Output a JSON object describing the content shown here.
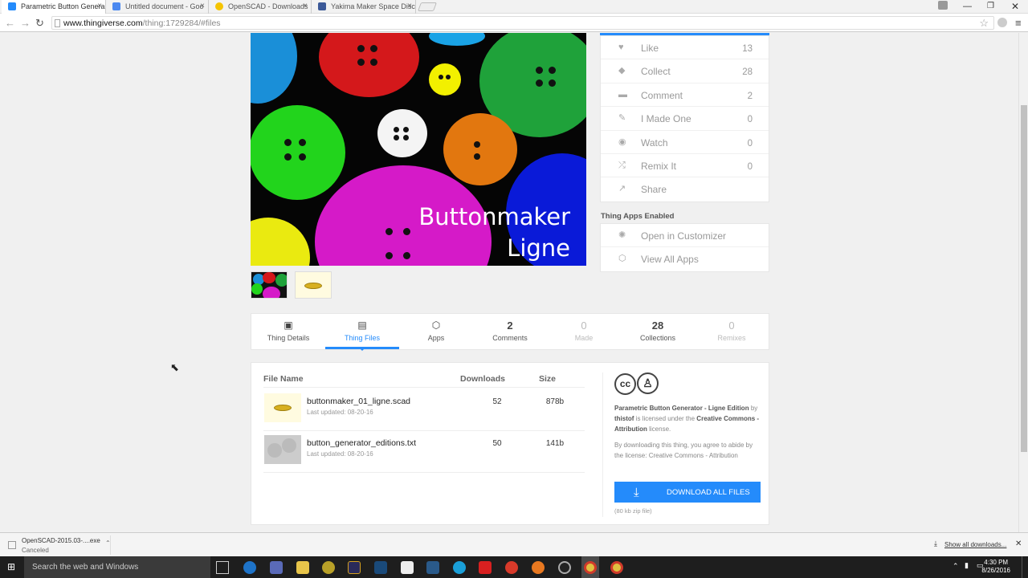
{
  "browser": {
    "tabs": [
      {
        "title": "Parametric Button Genera",
        "fav_color": "#248bfb"
      },
      {
        "title": "Untitled document - Goo",
        "fav_color": "#4a88f0"
      },
      {
        "title": "OpenSCAD - Downloads",
        "fav_color": "#f5c400"
      },
      {
        "title": "Yakima Maker Space Disc",
        "fav_color": "#3b5998"
      }
    ],
    "url_host": "www.thingiverse.com",
    "url_path": "/thing:1729284/#files"
  },
  "hero": {
    "title_line1": "Buttonmaker",
    "title_line2": "Ligne"
  },
  "actions": [
    {
      "label": "Like",
      "count": "13",
      "icon": "heart-icon",
      "glyph": "♥"
    },
    {
      "label": "Collect",
      "count": "28",
      "icon": "collect-icon",
      "glyph": "◆"
    },
    {
      "label": "Comment",
      "count": "2",
      "icon": "comment-icon",
      "glyph": "▬"
    },
    {
      "label": "I Made One",
      "count": "0",
      "icon": "made-one-icon",
      "glyph": "✎"
    },
    {
      "label": "Watch",
      "count": "0",
      "icon": "eye-icon",
      "glyph": "◉"
    },
    {
      "label": "Remix It",
      "count": "0",
      "icon": "remix-icon",
      "glyph": "⤮"
    },
    {
      "label": "Share",
      "count": "",
      "icon": "share-icon",
      "glyph": "↗"
    }
  ],
  "apps": {
    "heading": "Thing Apps Enabled",
    "items": [
      {
        "label": "Open in Customizer",
        "icon": "customizer-icon",
        "glyph": "✺"
      },
      {
        "label": "View All Apps",
        "icon": "cube-icon",
        "glyph": "⬡"
      }
    ]
  },
  "tabs": [
    {
      "label": "Thing Details",
      "num": "",
      "glyph": "▣"
    },
    {
      "label": "Thing Files",
      "num": "",
      "glyph": "▤"
    },
    {
      "label": "Apps",
      "num": "",
      "glyph": "⬡"
    },
    {
      "label": "Comments",
      "num": "2",
      "glyph": ""
    },
    {
      "label": "Made",
      "num": "0",
      "glyph": ""
    },
    {
      "label": "Collections",
      "num": "28",
      "glyph": ""
    },
    {
      "label": "Remixes",
      "num": "0",
      "glyph": ""
    }
  ],
  "files": {
    "headers": {
      "name": "File Name",
      "downloads": "Downloads",
      "size": "Size"
    },
    "rows": [
      {
        "name": "buttonmaker_01_ligne.scad",
        "updated": "Last updated: 08-20-16",
        "downloads": "52",
        "size": "878b"
      },
      {
        "name": "button_generator_editions.txt",
        "updated": "Last updated: 08-20-16",
        "downloads": "50",
        "size": "141b"
      }
    ]
  },
  "license": {
    "cc": "cc",
    "thing": "Parametric Button Generator - Ligne Edition",
    "by": "by",
    "author": "thistof",
    "licensed": "is licensed under the",
    "license_name": "Creative Commons - Attribution",
    "suffix": "license.",
    "agree": "By downloading this thing, you agree to abide by the license: Creative Commons - Attribution",
    "download_label": "DOWNLOAD ALL FILES",
    "zip_note": "(80 kb zip file)"
  },
  "download_bar": {
    "file": "OpenSCAD-2015.03-....exe",
    "status": "Canceled",
    "show_all": "Show all downloads..."
  },
  "taskbar": {
    "search": "Search the web and Windows",
    "time": "4:30 PM",
    "date": "8/26/2016"
  }
}
